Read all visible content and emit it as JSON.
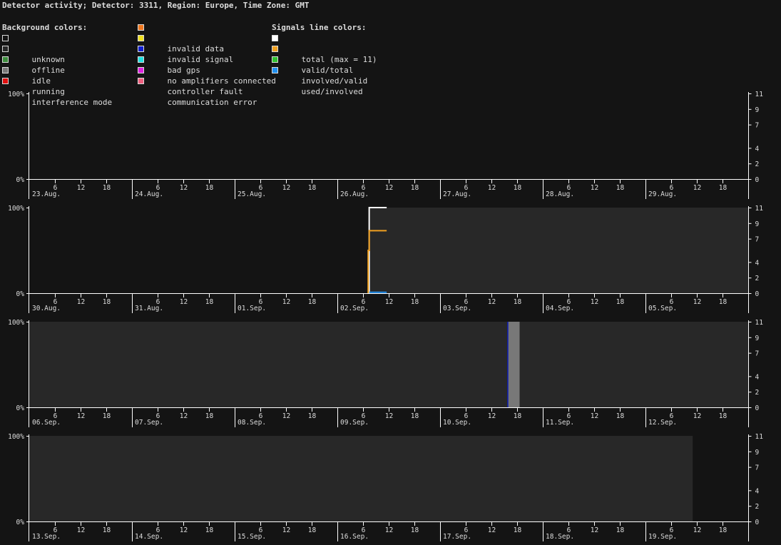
{
  "title": "Detector activity; Detector: 3311, Region: Europe, Time Zone: GMT",
  "legends": {
    "background_heading": "Background colors:",
    "signals_heading": "Signals line colors:",
    "background_left": [
      {
        "label": "unknown",
        "color": "#141414"
      },
      {
        "label": "offline",
        "color": "#282828"
      },
      {
        "label": "idle",
        "color": "#3c8c3c"
      },
      {
        "label": "running",
        "color": "#787878"
      },
      {
        "label": "interference mode",
        "color": "#e01010"
      }
    ],
    "background_right": [
      {
        "label": "invalid data",
        "color": "#f07820"
      },
      {
        "label": "invalid signal",
        "color": "#f0e020"
      },
      {
        "label": "bad gps",
        "color": "#1020d0"
      },
      {
        "label": "no amplifiers connected",
        "color": "#20e0e0"
      },
      {
        "label": "controller fault",
        "color": "#e020e0"
      },
      {
        "label": "communication error",
        "color": "#f06080"
      }
    ],
    "signals": [
      {
        "label": "total (max = 11)",
        "color": "#ffffff"
      },
      {
        "label": "valid/total",
        "color": "#f0a020"
      },
      {
        "label": "involved/valid",
        "color": "#30c030"
      },
      {
        "label": "used/involved",
        "color": "#2090f0"
      }
    ]
  },
  "chart_data": {
    "type": "area",
    "y_left_ticks": [
      "100%",
      "0%"
    ],
    "y_right_ticks": [
      "11",
      "9",
      "7",
      "4",
      "2",
      "0"
    ],
    "hour_ticks": [
      "6",
      "12",
      "18"
    ],
    "colors": {
      "offline": "#282828",
      "running": "#787878",
      "bad_gps": "#1020d0",
      "total": "#ffffff",
      "valid_total": "#f0a020",
      "used_involved": "#2090f0"
    },
    "panels": [
      {
        "days": [
          "23.Aug.",
          "24.Aug.",
          "25.Aug.",
          "26.Aug.",
          "27.Aug.",
          "28.Aug.",
          "29.Aug."
        ],
        "segments": [],
        "lines": []
      },
      {
        "days": [
          "30.Aug.",
          "31.Aug.",
          "01.Sep.",
          "02.Sep.",
          "03.Sep.",
          "04.Sep.",
          "05.Sep."
        ],
        "segments": [
          {
            "state": "offline",
            "start_day": 3.31,
            "end_day": 7
          }
        ],
        "lines": [
          {
            "series": "total",
            "points": [
              [
                3.31,
                0
              ],
              [
                3.31,
                11
              ],
              [
                3.48,
                11
              ]
            ]
          },
          {
            "series": "valid_total",
            "points": [
              [
                3.3,
                0
              ],
              [
                3.3,
                0.5
              ],
              [
                3.31,
                0.5
              ],
              [
                3.31,
                0.73
              ],
              [
                3.48,
                0.73
              ]
            ]
          },
          {
            "series": "used_involved",
            "points": [
              [
                3.31,
                0.01
              ],
              [
                3.48,
                0.01
              ]
            ]
          }
        ]
      },
      {
        "days": [
          "06.Sep.",
          "07.Sep.",
          "08.Sep.",
          "09.Sep.",
          "10.Sep.",
          "11.Sep.",
          "12.Sep."
        ],
        "segments": [
          {
            "state": "offline",
            "start_day": 0,
            "end_day": 4.655
          },
          {
            "state": "bad_gps",
            "start_day": 4.655,
            "end_day": 4.665
          },
          {
            "state": "running",
            "start_day": 4.665,
            "end_day": 4.775
          },
          {
            "state": "offline",
            "start_day": 4.775,
            "end_day": 7
          }
        ],
        "lines": []
      },
      {
        "days": [
          "13.Sep.",
          "14.Sep.",
          "15.Sep.",
          "16.Sep.",
          "17.Sep.",
          "18.Sep.",
          "19.Sep."
        ],
        "segments": [
          {
            "state": "offline",
            "start_day": 0,
            "end_day": 6.46
          }
        ],
        "lines": []
      }
    ]
  }
}
